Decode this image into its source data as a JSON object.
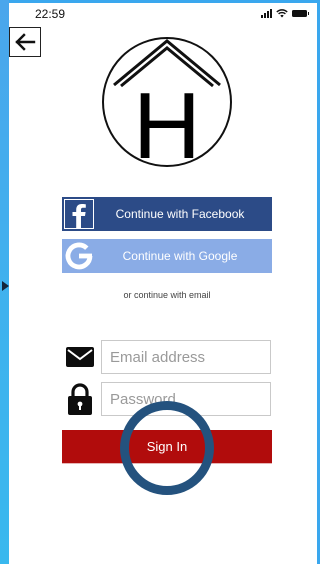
{
  "status_bar": {
    "time": "22:59"
  },
  "auth": {
    "facebook_label": "Continue with Facebook",
    "google_label": "Continue with Google",
    "or_email_text": "or continue with email",
    "email_placeholder": "Email address",
    "password_placeholder": "Password",
    "signin_label": "Sign In"
  },
  "logo_letter": "H",
  "icons": {
    "back": "left-arrow-icon",
    "facebook": "facebook-icon",
    "google": "google-icon",
    "email": "envelope-icon",
    "password": "lock-icon"
  },
  "colors": {
    "facebook": "#2c4b87",
    "google": "#8aace6",
    "signin": "#b10c0c",
    "click_ring": "#24527e"
  }
}
